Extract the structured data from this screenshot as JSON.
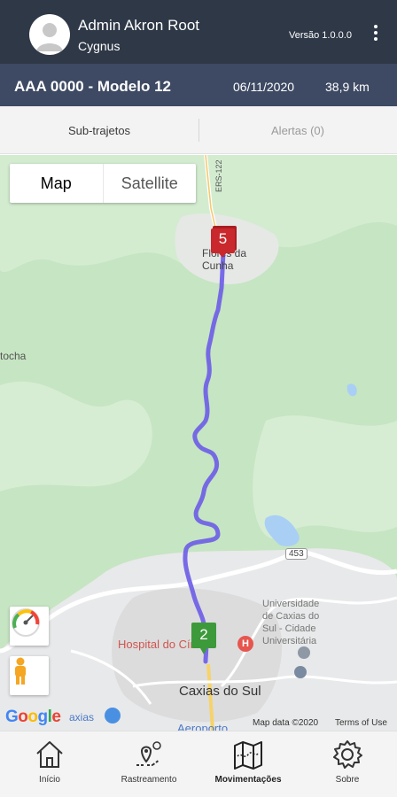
{
  "header": {
    "user_name": "Admin Akron Root",
    "company": "Cygnus",
    "version": "Versão 1.0.0.0"
  },
  "vehicle": {
    "name": "AAA 0000 - Modelo 12",
    "date": "06/11/2020",
    "distance": "38,9 km"
  },
  "tabs": {
    "subroutes": "Sub-trajetos",
    "alerts": "Alertas (0)"
  },
  "map": {
    "type_map": "Map",
    "type_satellite": "Satellite",
    "route_color": "#6b5ce7",
    "marker_start_label": "2",
    "marker_start_color": "#3d9a3a",
    "marker_end_label": "5",
    "marker_end_color": "#c9282d",
    "labels": {
      "city_north": "Flores da Cunha",
      "city_north_line1": "Flores da",
      "city_north_line2": "Cunha",
      "town_west": "tocha",
      "road_north": "ERS-122",
      "road_453": "453",
      "university_line1": "Universidade",
      "university_line2": "de Caxias do",
      "university_line3": "Sul - Cidade",
      "university_line4": "Universitária",
      "hospital": "Hospital do Círculo",
      "city_main": "Caxias do Sul",
      "airport": "Aeroporto",
      "caxias_small": "axias"
    },
    "google": "Google",
    "map_data": "Map data ©2020",
    "terms": "Terms of Use"
  },
  "nav": {
    "items": [
      {
        "label": "Início"
      },
      {
        "label": "Rastreamento"
      },
      {
        "label": "Movimentações"
      },
      {
        "label": "Sobre"
      }
    ],
    "active_index": 2
  }
}
